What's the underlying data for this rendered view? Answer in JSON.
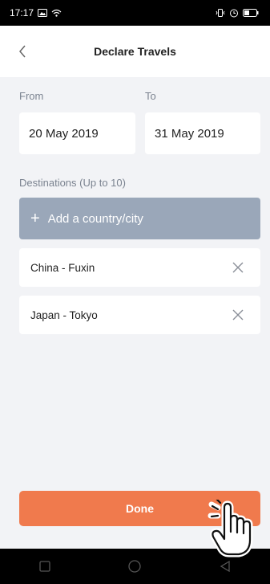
{
  "status_bar": {
    "time": "17:17"
  },
  "header": {
    "title": "Declare Travels"
  },
  "dates": {
    "from_label": "From",
    "from_value": "20 May 2019",
    "to_label": "To",
    "to_value": "31 May 2019"
  },
  "destinations": {
    "label": "Destinations (Up to 10)",
    "add_label": "Add a country/city",
    "items": [
      {
        "label": "China - Fuxin"
      },
      {
        "label": "Japan - Tokyo"
      }
    ]
  },
  "done_label": "Done",
  "colors": {
    "accent": "#f07a4d",
    "add_button": "#9aa7b9",
    "background": "#f2f3f6"
  },
  "icons": [
    "back-chevron-icon",
    "plus-icon",
    "close-icon",
    "tap-hand-icon"
  ]
}
